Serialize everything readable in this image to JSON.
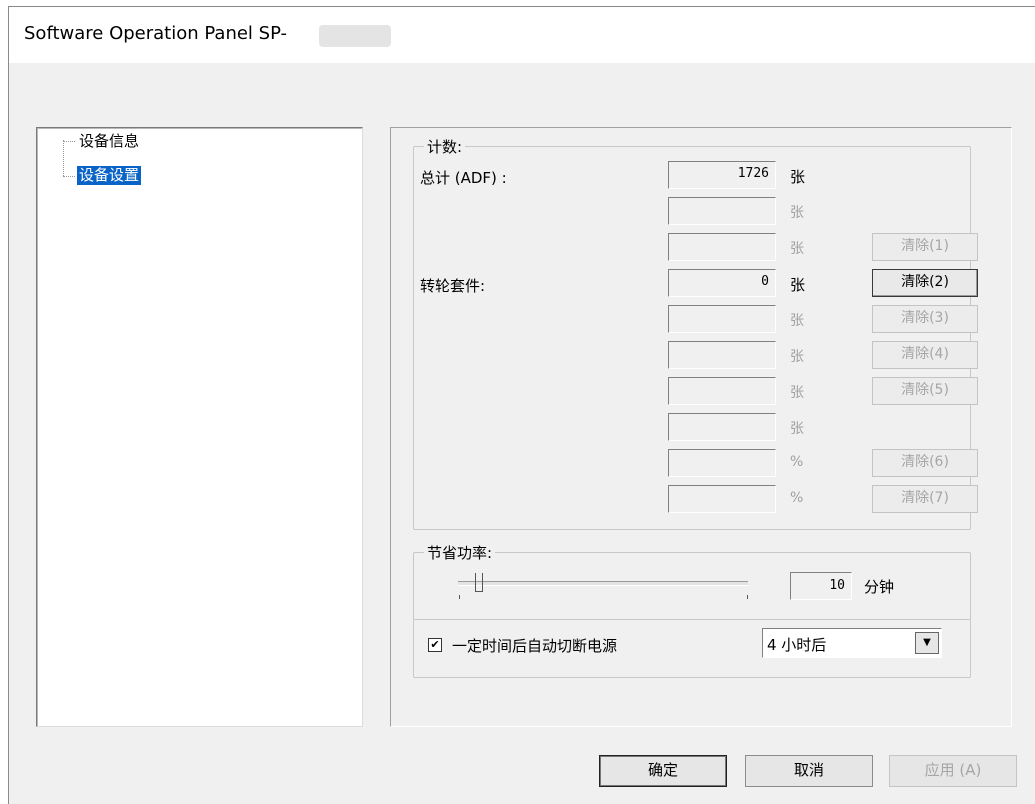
{
  "window": {
    "title": "Software Operation Panel SP-"
  },
  "tree": {
    "items": [
      {
        "label": "设备信息",
        "selected": false
      },
      {
        "label": "设备设置",
        "selected": true
      }
    ]
  },
  "count_group": {
    "legend": "计数:",
    "total_label": "总计 (ADF) :",
    "roller_label": "转轮套件:",
    "rows": [
      {
        "value": "1726",
        "unit": "张",
        "unit_enabled": true,
        "button": ""
      },
      {
        "value": "",
        "unit": "张",
        "unit_enabled": false,
        "button": ""
      },
      {
        "value": "",
        "unit": "张",
        "unit_enabled": false,
        "button": "清除(1)",
        "button_enabled": false
      },
      {
        "value": "0",
        "unit": "张",
        "unit_enabled": true,
        "button": "清除(2)",
        "button_enabled": true
      },
      {
        "value": "",
        "unit": "张",
        "unit_enabled": false,
        "button": "清除(3)",
        "button_enabled": false
      },
      {
        "value": "",
        "unit": "张",
        "unit_enabled": false,
        "button": "清除(4)",
        "button_enabled": false
      },
      {
        "value": "",
        "unit": "张",
        "unit_enabled": false,
        "button": "清除(5)",
        "button_enabled": false
      },
      {
        "value": "",
        "unit": "张",
        "unit_enabled": false,
        "button": ""
      },
      {
        "value": "",
        "unit": "%",
        "unit_enabled": false,
        "button": "清除(6)",
        "button_enabled": false
      },
      {
        "value": "",
        "unit": "%",
        "unit_enabled": false,
        "button": "清除(7)",
        "button_enabled": false
      }
    ]
  },
  "power_group": {
    "legend": "节省功率:",
    "minutes_value": "10",
    "minutes_unit": "分钟",
    "slider_level_fraction": 0.06
  },
  "auto_off": {
    "checked": true,
    "check_mark": "✔",
    "label": "一定时间后自动切断电源",
    "selected_option": "4 小时后",
    "arrow": "▼"
  },
  "buttons": {
    "ok": "确定",
    "cancel": "取消",
    "apply": "应用 (A)"
  },
  "colors": {
    "selection": "#0a64c8",
    "disabled_text": "#a0a0a0"
  }
}
